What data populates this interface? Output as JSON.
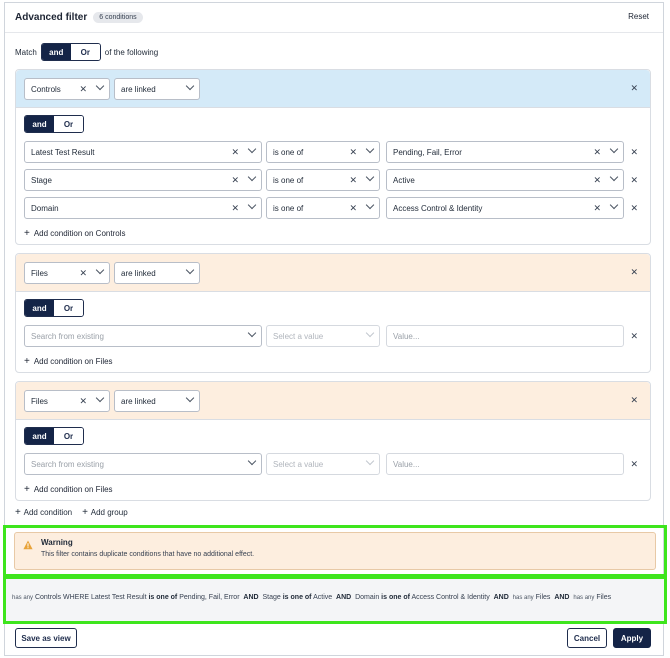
{
  "header": {
    "title": "Advanced filter",
    "badge": "6 conditions",
    "reset": "Reset"
  },
  "match": {
    "label": "Match",
    "and": "and",
    "or": "Or",
    "suffix": "of the following"
  },
  "group1": {
    "entity": "Controls",
    "relation": "are linked",
    "and": "and",
    "or": "Or",
    "rows": [
      {
        "field": "Latest Test Result",
        "op": "is one of",
        "value": "Pending, Fail, Error"
      },
      {
        "field": "Stage",
        "op": "is one of",
        "value": "Active"
      },
      {
        "field": "Domain",
        "op": "is one of",
        "value": "Access Control & Identity"
      }
    ],
    "add": "Add condition on Controls"
  },
  "group2": {
    "entity": "Files",
    "relation": "are linked",
    "and": "and",
    "or": "Or",
    "search_placeholder": "Search from existing",
    "select_placeholder": "Select a value",
    "value_placeholder": "Value...",
    "add": "Add condition on Files"
  },
  "group3": {
    "entity": "Files",
    "relation": "are linked",
    "and": "and",
    "or": "Or",
    "search_placeholder": "Search from existing",
    "select_placeholder": "Select a value",
    "value_placeholder": "Value...",
    "add": "Add condition on Files"
  },
  "actions": {
    "add_condition": "Add condition",
    "add_group": "Add group"
  },
  "warning": {
    "title": "Warning",
    "text": "This filter contains duplicate conditions that have no additional effect."
  },
  "summary": {
    "has_any_1": "has any",
    "controls": "Controls",
    "where": "WHERE",
    "f1": "Latest Test Result",
    "op1": "is one of",
    "v1": "Pending, Fail, Error",
    "and1": "AND",
    "f2": "Stage",
    "op2": "is one of",
    "v2": "Active",
    "and2": "AND",
    "f3": "Domain",
    "op3": "is one of",
    "v3": "Access Control & Identity",
    "and3": "AND",
    "has_any_2": "has any",
    "files1": "Files",
    "and4": "AND",
    "has_any_3": "has any",
    "files2": "Files"
  },
  "footer": {
    "save": "Save as view",
    "cancel": "Cancel",
    "apply": "Apply"
  },
  "colors": {
    "primary": "#142447",
    "info_bg": "#d4eaf8",
    "warn_bg": "#fdeedf",
    "highlight": "#3ee51d"
  }
}
